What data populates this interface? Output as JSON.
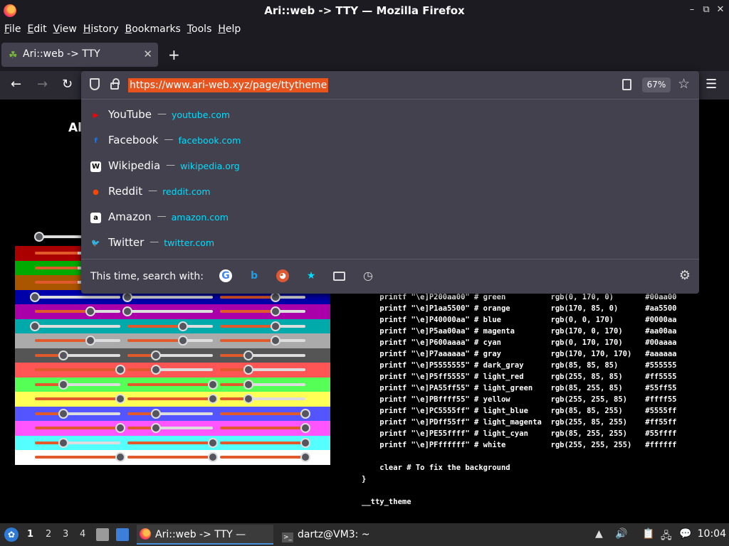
{
  "window": {
    "title": "Ari::web -> TTY — Mozilla Firefox",
    "controls": [
      "–",
      "⧉",
      "✕"
    ]
  },
  "menu": [
    "File",
    "Edit",
    "View",
    "History",
    "Bookmarks",
    "Tools",
    "Help"
  ],
  "tab": {
    "label": "Ari::web -> TTY",
    "favicon": "leaf-icon",
    "close": "✕"
  },
  "new_tab": "+",
  "urlbar": {
    "url": "https://www.ari-web.xyz/page/ttytheme",
    "zoom": "67%"
  },
  "suggestions": [
    {
      "name": "YouTube",
      "domain": "youtube.com",
      "icon": "youtube-icon",
      "icon_text": "▶",
      "color": "#ff0000"
    },
    {
      "name": "Facebook",
      "domain": "facebook.com",
      "icon": "facebook-icon",
      "icon_text": "f",
      "color": "#1877f2"
    },
    {
      "name": "Wikipedia",
      "domain": "wikipedia.org",
      "icon": "wikipedia-icon",
      "icon_text": "W",
      "color": "#ffffff"
    },
    {
      "name": "Reddit",
      "domain": "reddit.com",
      "icon": "reddit-icon",
      "icon_text": "●",
      "color": "#ff4500"
    },
    {
      "name": "Amazon",
      "domain": "amazon.com",
      "icon": "amazon-icon",
      "icon_text": "a",
      "color": "#ffffff"
    },
    {
      "name": "Twitter",
      "domain": "twitter.com",
      "icon": "twitter-icon",
      "icon_text": "🐦",
      "color": "#1da1f2"
    }
  ],
  "search_with": {
    "label": "This time, search with:",
    "engines": [
      "google-icon",
      "bing-icon",
      "duckduckgo-icon",
      "bookmarks-star-icon",
      "tabs-icon",
      "history-clock-icon"
    ]
  },
  "page": {
    "title": "Al",
    "swatch_colors": [
      "#aa0000",
      "#00aa00",
      "#aa5500",
      "#0000aa",
      "#aa00aa",
      "#00aaaa",
      "#aaaaaa",
      "#555555",
      "#ff5555",
      "#55ff55",
      "#ffff55",
      "#5555ff",
      "#ff55ff",
      "#55ffff",
      "#ffffff"
    ],
    "code_lines": [
      "    printf \"\\e]P200aa00\" # green          rgb(0, 170, 0)       #00aa00",
      "    printf \"\\e]P1aa5500\" # orange         rgb(170, 85, 0)      #aa5500",
      "    printf \"\\e]P40000aa\" # blue           rgb(0, 0, 170)       #0000aa",
      "    printf \"\\e]P5aa00aa\" # magenta        rgb(170, 0, 170)     #aa00aa",
      "    printf \"\\e]P600aaaa\" # cyan           rgb(0, 170, 170)     #00aaaa",
      "    printf \"\\e]P7aaaaaa\" # gray           rgb(170, 170, 170)   #aaaaaa",
      "    printf \"\\e]P5555555\" # dark_gray      rgb(85, 85, 85)      #555555",
      "    printf \"\\e]P5ff5555\" # light_red      rgb(255, 85, 85)     #ff5555",
      "    printf \"\\e]PA55ff55\" # light_green    rgb(85, 255, 85)     #55ff55",
      "    printf \"\\e]PBffff55\" # yellow         rgb(255, 255, 85)    #ffff55",
      "    printf \"\\e]PC5555ff\" # light_blue     rgb(85, 85, 255)     #5555ff",
      "    printf \"\\e]PDff55ff\" # light_magenta  rgb(255, 85, 255)    #ff55ff",
      "    printf \"\\e]PE55ffff\" # light_cyan     rgb(85, 255, 255)    #55ffff",
      "    printf \"\\e]PFffffff\" # white          rgb(255, 255, 255)   #ffffff",
      "",
      "    clear # To fix the background",
      "}",
      "",
      "__tty_theme"
    ]
  },
  "taskbar": {
    "workspaces": [
      "1",
      "2",
      "3",
      "4"
    ],
    "tasks": [
      {
        "label": "Ari::web -> TTY — Mo…",
        "icon": "firefox-icon"
      },
      {
        "label": "dartz@VM3: ~",
        "icon": "terminal-icon"
      }
    ],
    "clock": "10:04"
  }
}
